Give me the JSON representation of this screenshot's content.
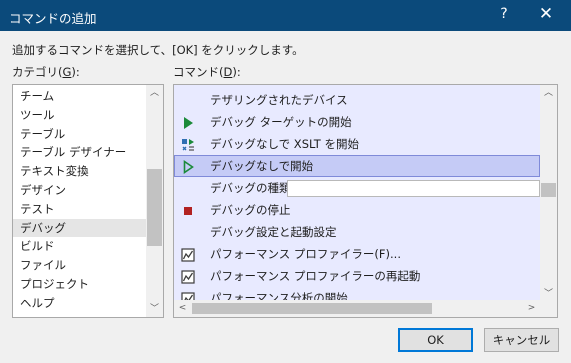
{
  "window": {
    "title": "コマンドの追加",
    "help_glyph": "?",
    "close_glyph": "✕"
  },
  "instruction": "追加するコマンドを選択して、[OK] をクリックします。",
  "category_label": {
    "prefix": "カテゴリ(",
    "key": "G",
    "suffix": "):"
  },
  "command_label": {
    "prefix": "コマンド(",
    "key": "D",
    "suffix": "):"
  },
  "categories": [
    "チーム",
    "ツール",
    "テーブル",
    "テーブル デザイナー",
    "テキスト変換",
    "デザイン",
    "テスト",
    "デバッグ",
    "ビルド",
    "ファイル",
    "プロジェクト",
    "ヘルプ"
  ],
  "selected_category": "デバッグ",
  "commands": [
    {
      "label": "テザリングされたデバイス",
      "icon": "none"
    },
    {
      "label": "デバッグ ターゲットの開始",
      "icon": "play-filled-icon"
    },
    {
      "label": "デバッグなしで XSLT を開始",
      "icon": "xslt-run-icon"
    },
    {
      "label": "デバッグなしで開始",
      "icon": "play-outline-icon",
      "selected": true
    },
    {
      "label": "デバッグの種類",
      "icon": "none",
      "has_combo": true,
      "combo_value": ""
    },
    {
      "label": "デバッグの停止",
      "icon": "stop-icon"
    },
    {
      "label": "デバッグ設定と起動設定",
      "icon": "none"
    },
    {
      "label": "パフォーマンス プロファイラー(F)...",
      "icon": "profiler-icon"
    },
    {
      "label": "パフォーマンス プロファイラーの再起動",
      "icon": "profiler-icon"
    },
    {
      "label": "パフォーマンス分析の開始",
      "icon": "profiler-icon"
    }
  ],
  "buttons": {
    "ok": "OK",
    "cancel": "キャンセル"
  },
  "colors": {
    "titlebar": "#0b4a7b",
    "command_list_bg": "#e8eaff",
    "selected_command_bg": "#c5cbf6",
    "play_green": "#1b8a3a",
    "stop_red": "#b22222"
  }
}
